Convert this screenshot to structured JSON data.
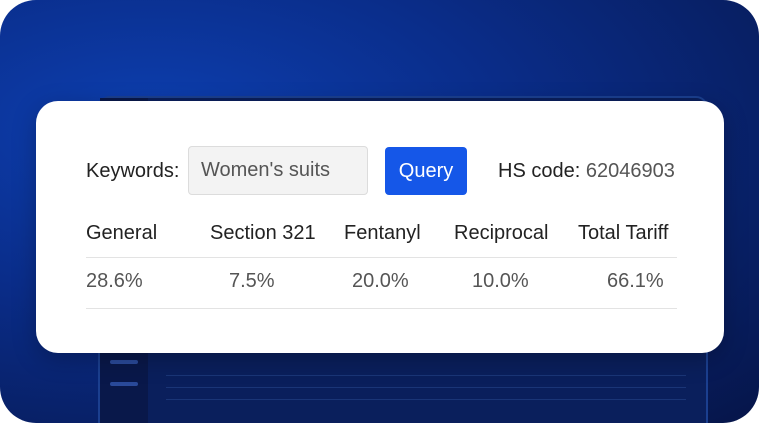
{
  "search": {
    "keywords_label": "Keywords:",
    "keywords_value": "Women's suits",
    "query_button": "Query",
    "hs_code_label": "HS code:",
    "hs_code_value": "62046903"
  },
  "tariff_table": {
    "headers": [
      "General",
      "Section 321",
      "Fentanyl",
      "Reciprocal",
      "Total Tariff"
    ],
    "values": [
      "28.6%",
      "7.5%",
      "20.0%",
      "10.0%",
      "66.1%"
    ]
  },
  "colors": {
    "background": "#0a2d8a",
    "card": "#ffffff",
    "accent": "#1557e8"
  }
}
